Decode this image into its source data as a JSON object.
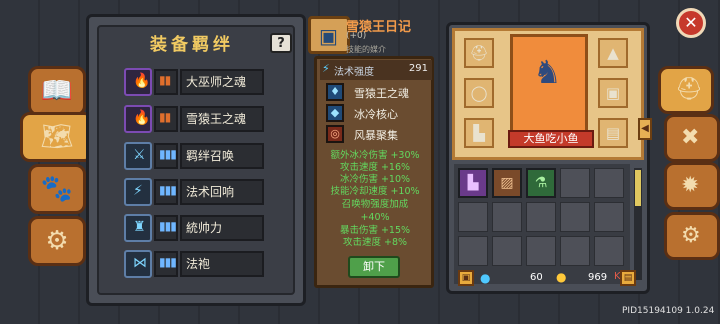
{
  "left_tabs": [
    {
      "icon": "book-icon",
      "glyph": "📖"
    },
    {
      "icon": "map-icon",
      "glyph": "🗺"
    },
    {
      "icon": "paw-icon",
      "glyph": "🐾"
    },
    {
      "icon": "wheel-icon",
      "glyph": "⚙"
    }
  ],
  "bonds_panel": {
    "title": "装备羁绊",
    "help": "?",
    "rows": [
      {
        "label": "大巫师之魂",
        "icon": "purple-flame-icon",
        "glyph": "🔥",
        "count": "▮▮"
      },
      {
        "label": "雪猿王之魂",
        "icon": "purple-flame-icon",
        "glyph": "🔥",
        "count": "▮▮"
      },
      {
        "label": "羁绊召唤",
        "icon": "staff-icon",
        "glyph": "⚔",
        "count": "▮▮▮"
      },
      {
        "label": "法术回响",
        "icon": "wand-icon",
        "glyph": "⚡",
        "count": "▮▮▮"
      },
      {
        "label": "統帅力",
        "icon": "totem-icon",
        "glyph": "♜",
        "count": "▮▮▮"
      },
      {
        "label": "法袍",
        "icon": "robe-icon",
        "glyph": "⋈",
        "count": "▮▮▮"
      }
    ]
  },
  "item": {
    "name": "雪猿王日记",
    "level": "(+0)",
    "sub": "技能的媒介",
    "stat": {
      "label": "法术强度",
      "value": "291"
    },
    "effects": [
      {
        "label": "雪猿王之魂",
        "icon": "flame-icon",
        "glyph": "♦"
      },
      {
        "label": "冰冷核心",
        "icon": "crystal-icon",
        "glyph": "◆"
      },
      {
        "label": "风暴聚集",
        "icon": "vortex-icon",
        "glyph": "◎"
      }
    ],
    "bonuses": [
      "额外冰冷伤害 +30%",
      "攻击速度 +16%",
      "冰冷伤害 +10%",
      "技能冷却速度 +10%",
      "召唤物强度加成",
      "+40%",
      "暴击伤害 +15%",
      "攻击速度 +8%"
    ],
    "unload_label": "卸下"
  },
  "character": {
    "name": "大鱼吃小鱼",
    "slots_left": [
      {
        "icon": "helmet-icon",
        "glyph": "⛑"
      },
      {
        "icon": "ring-icon",
        "glyph": "◯"
      },
      {
        "icon": "boots-icon",
        "glyph": "▙"
      }
    ],
    "slots_right": [
      {
        "icon": "wizard-hat-icon",
        "glyph": "▲"
      },
      {
        "icon": "armor-icon",
        "glyph": "▣"
      },
      {
        "icon": "book-item-icon",
        "glyph": "▤"
      }
    ]
  },
  "inventory": {
    "items": [
      {
        "icon": "purple-boots-icon",
        "glyph": "▙",
        "bg": "#6a3a8a"
      },
      {
        "icon": "chest-icon",
        "glyph": "▨",
        "bg": "#7a4a2a"
      },
      {
        "icon": "green-potion-icon",
        "glyph": "⚗",
        "bg": "#2f6a3a"
      }
    ],
    "gems": "60",
    "coins": "969",
    "coin_suffix": "K"
  },
  "right_tabs": [
    {
      "icon": "helmet-tab-icon",
      "glyph": "⛑"
    },
    {
      "icon": "crossed-tools-icon",
      "glyph": "✖"
    },
    {
      "icon": "gear-tab-icon",
      "glyph": "✹"
    },
    {
      "icon": "settings-icon",
      "glyph": "⚙"
    }
  ],
  "close_glyph": "✕",
  "pid": "PID15194109 1.0.24",
  "colors": {
    "gold": "#f1ca62",
    "bonus_green": "#63d85f",
    "item_orange": "#f19a4a"
  }
}
